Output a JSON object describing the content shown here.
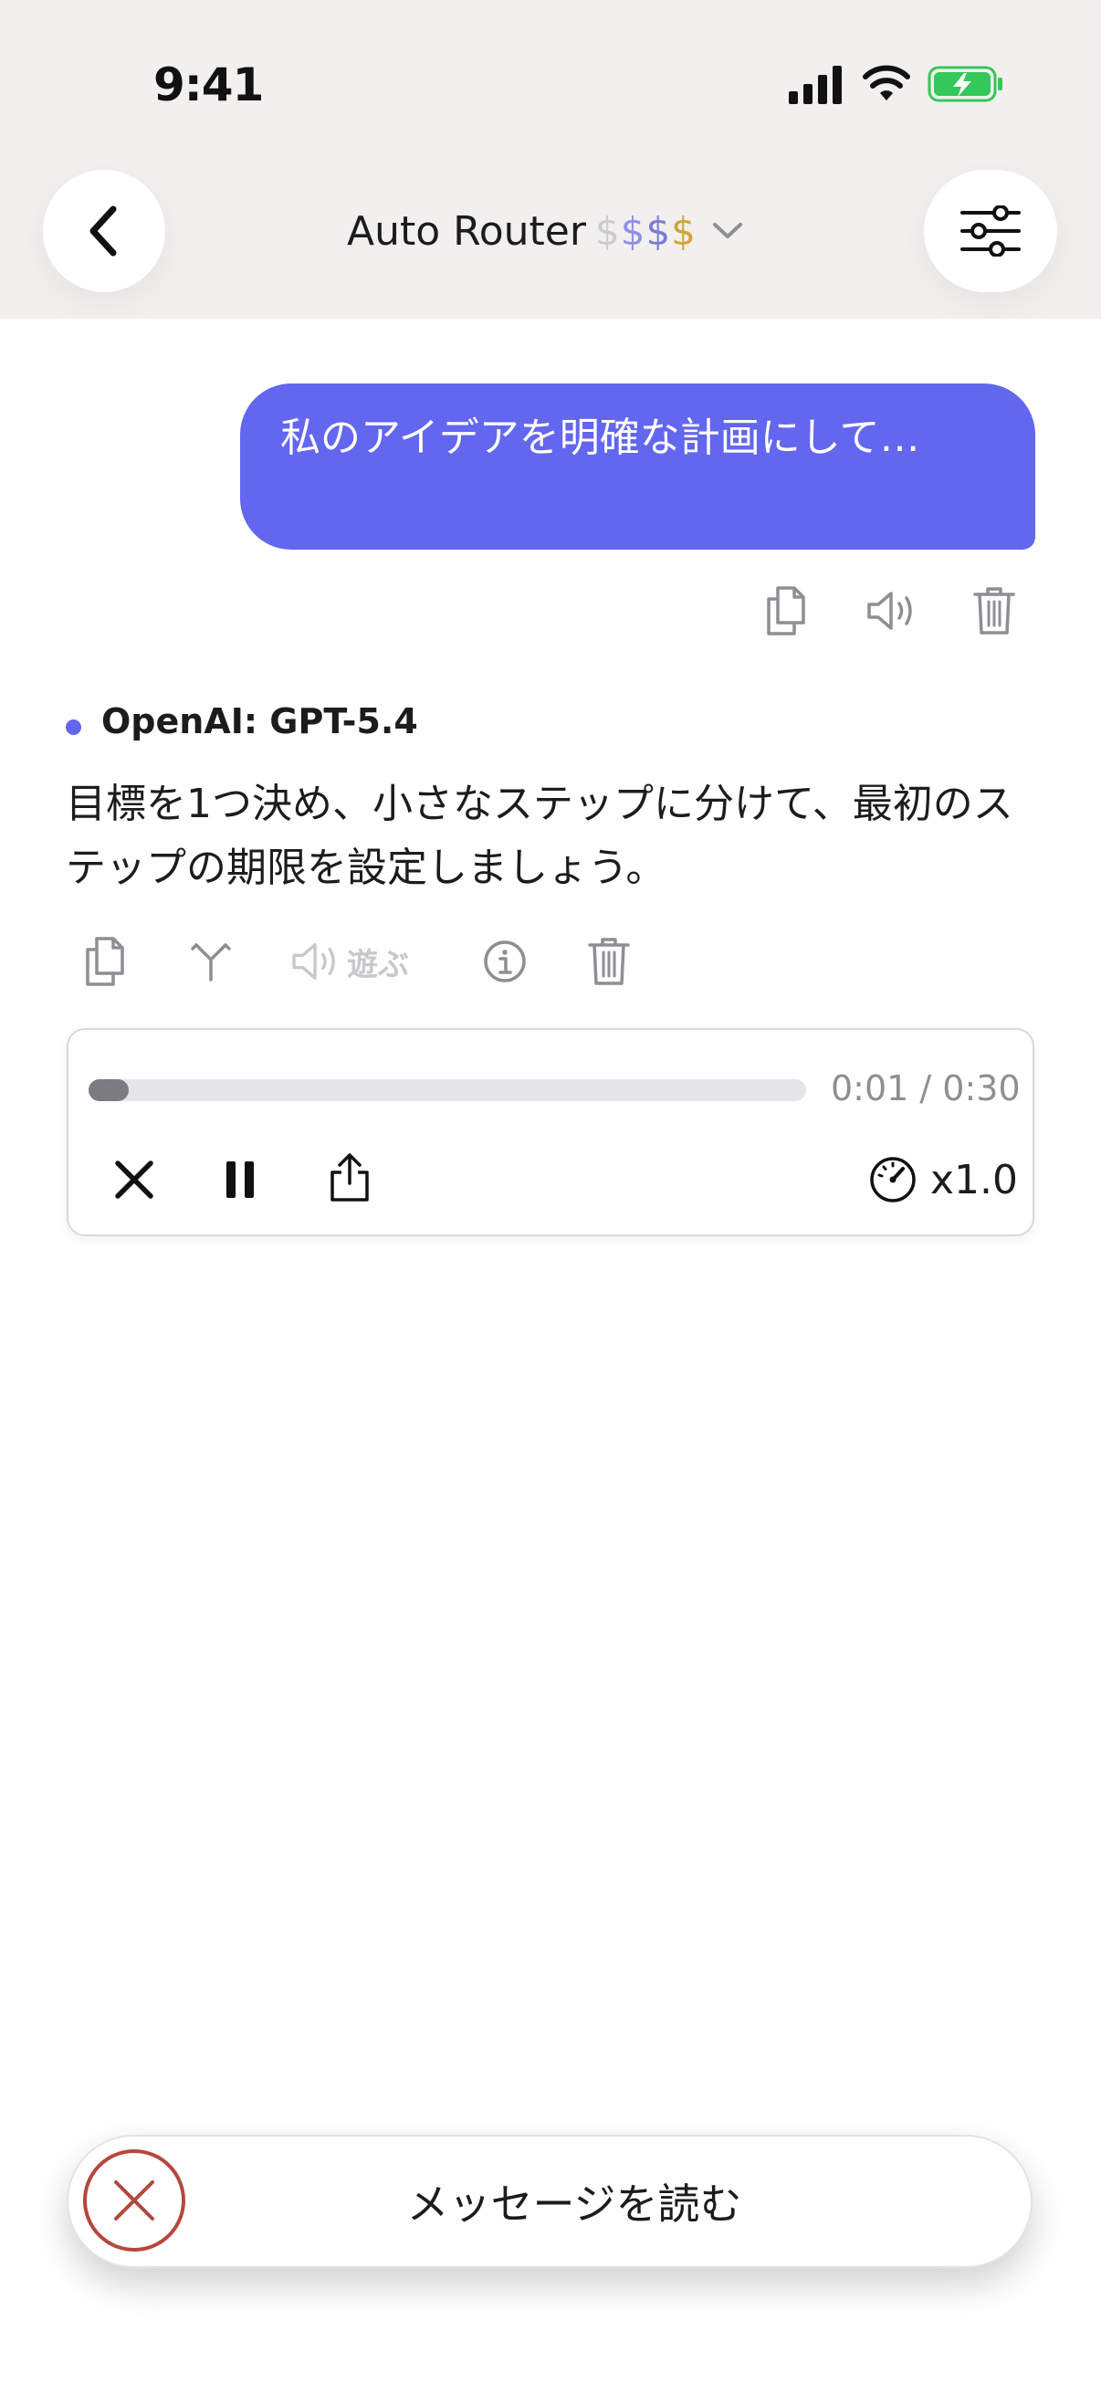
{
  "status_bar": {
    "time": "9:41"
  },
  "header": {
    "title": "Auto Router",
    "price_signs": [
      "$",
      "$",
      "$",
      "$"
    ]
  },
  "user_message": {
    "text": "私のアイデアを明確な計画にして…"
  },
  "assistant": {
    "model_name": "OpenAI: GPT-5.4",
    "text": "目標を1つ決め、小さなステップに分けて、最初のステップの期限を設定しましょう。",
    "play_label": "遊ぶ"
  },
  "audio_player": {
    "elapsed_time": "0:01 / 0:30",
    "progress_fraction": 0.033,
    "speed_label": "x1.0"
  },
  "read_bar": {
    "label": "メッセージを読む"
  },
  "colors": {
    "accent": "#6366ef",
    "header_bg": "#f1f0ee",
    "cancel_red": "#b5473f"
  },
  "icons": [
    "back-chevron-icon",
    "sliders-icon",
    "chevron-down-icon",
    "copy-icon",
    "speaker-icon",
    "trash-icon",
    "fork-icon",
    "info-icon",
    "close-icon",
    "pause-icon",
    "share-icon",
    "speedometer-icon",
    "cancel-circle-icon"
  ]
}
